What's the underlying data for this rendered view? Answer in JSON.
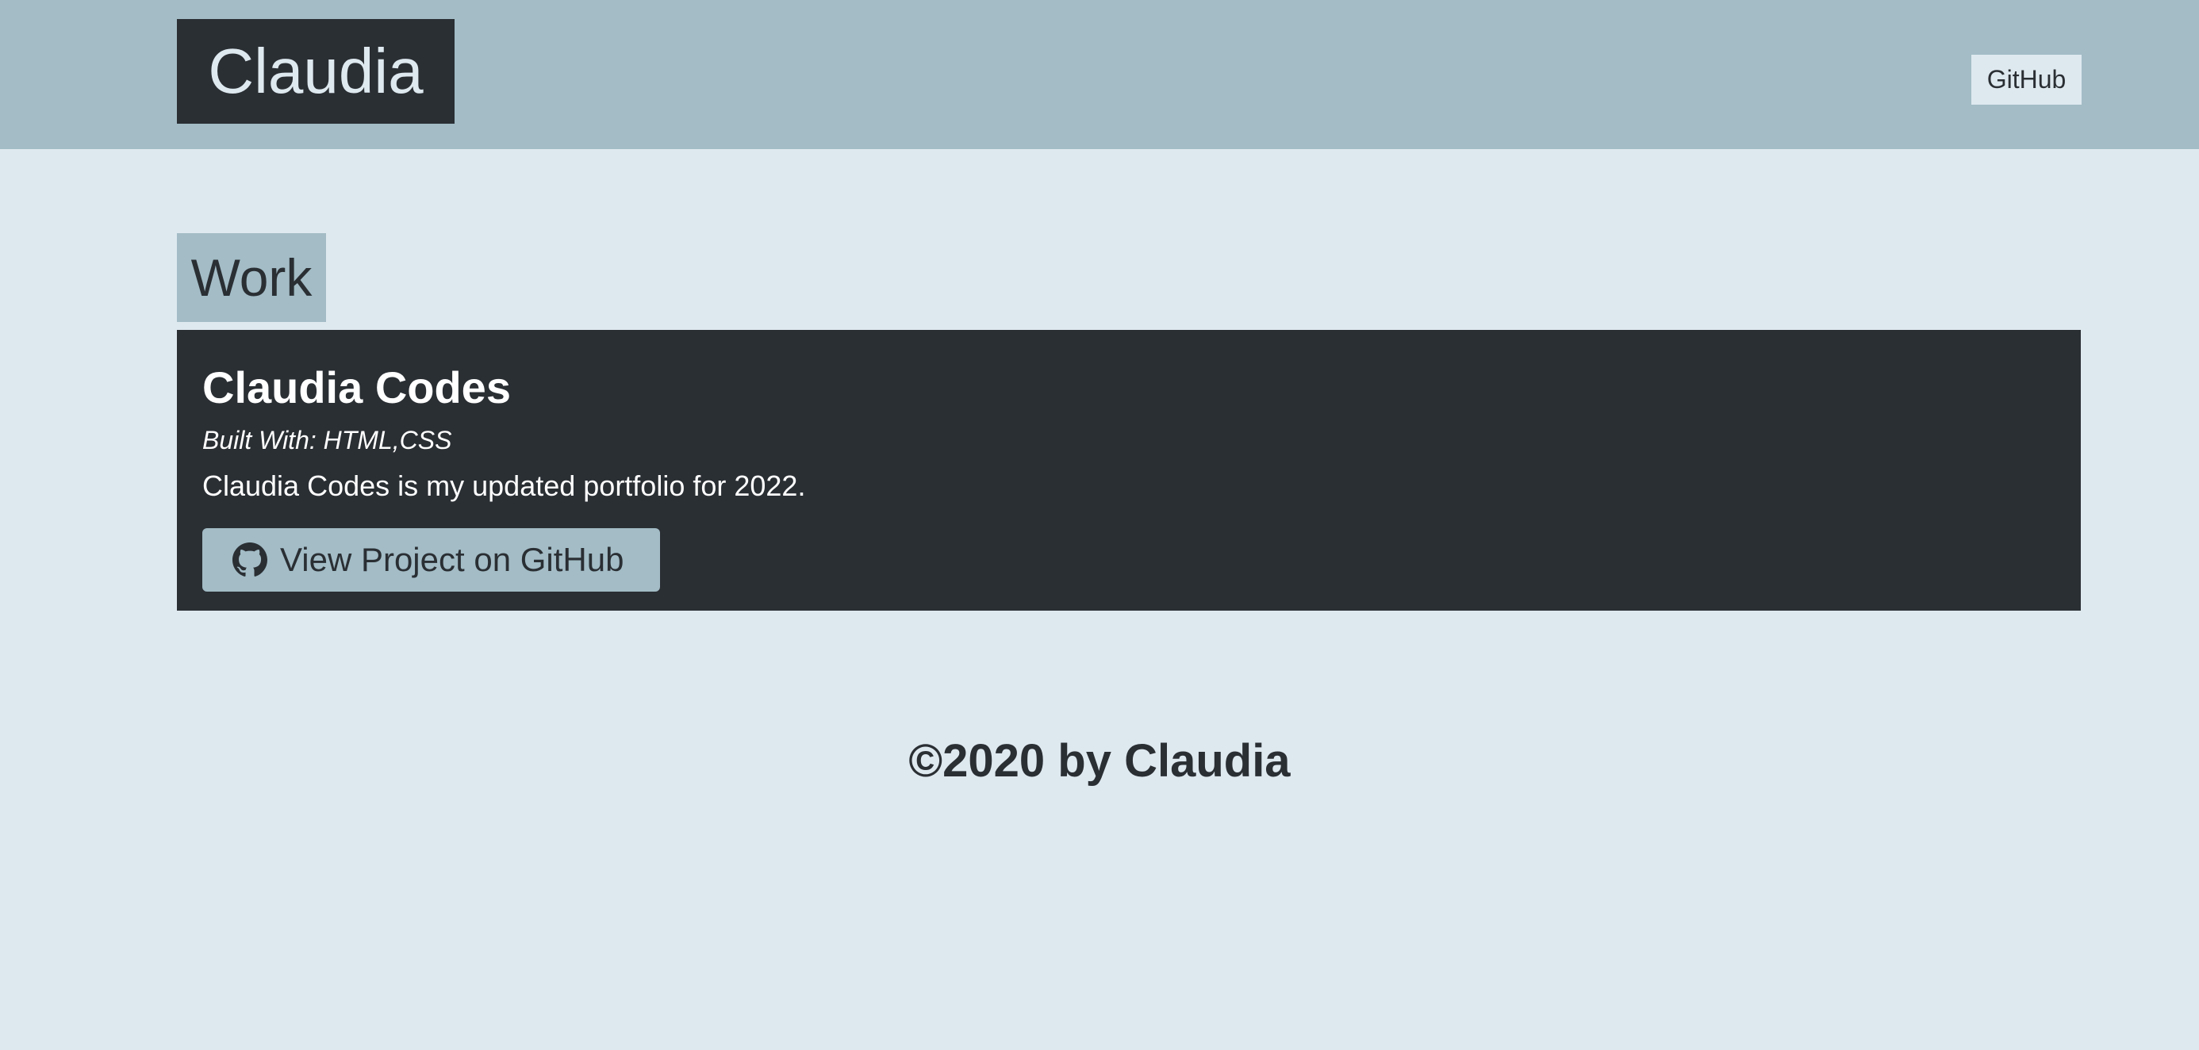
{
  "header": {
    "brand": "Claudia",
    "nav_github": "GitHub"
  },
  "work": {
    "title": "Work",
    "projects": [
      {
        "name": "Claudia Codes",
        "built_with": "Built With: HTML,CSS",
        "description": "Claudia Codes is my updated portfolio for 2022.",
        "button_label": "View Project on GitHub",
        "button_icon": "github-icon"
      }
    ]
  },
  "footer": {
    "text": "©2020 by Claudia"
  },
  "colors": {
    "background": "#dee9ef",
    "accent": "#a3bcc6",
    "dark": "#2a2f34"
  }
}
